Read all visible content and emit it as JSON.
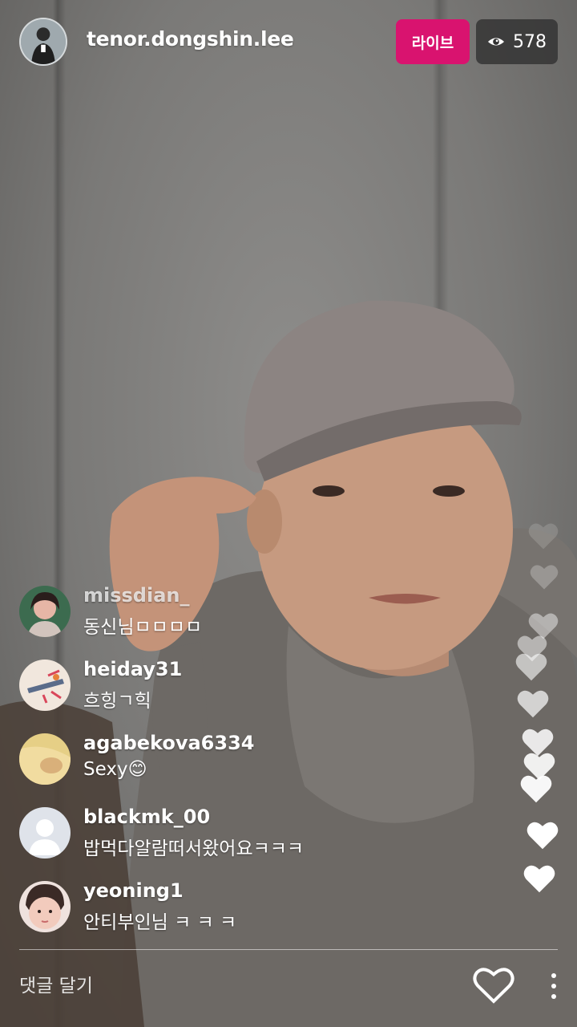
{
  "header": {
    "username": "tenor.dongshin.lee",
    "live_label": "라이브",
    "viewer_count": "578",
    "viewer_icon": "eye-icon"
  },
  "comments": [
    {
      "username": "missdian_",
      "text": "동신님ㅁㅁㅁㅁ"
    },
    {
      "username": "heiday31",
      "text": "흐힝ㄱ힉"
    },
    {
      "username": "agabekova6334",
      "text": "Sexy😊"
    },
    {
      "username": "blackmk_00",
      "text": "밥먹다알람떠서왔어요ㅋㅋㅋ"
    },
    {
      "username": "yeoning1",
      "text": "안티부인님 ㅋ ㅋ ㅋ"
    }
  ],
  "footer": {
    "comment_placeholder": "댓글 달기",
    "like_icon": "heart-icon",
    "more_icon": "more-vertical-icon"
  },
  "colors": {
    "live_badge": "#d9136f",
    "viewer_badge": "#323232",
    "text": "#ffffff"
  }
}
